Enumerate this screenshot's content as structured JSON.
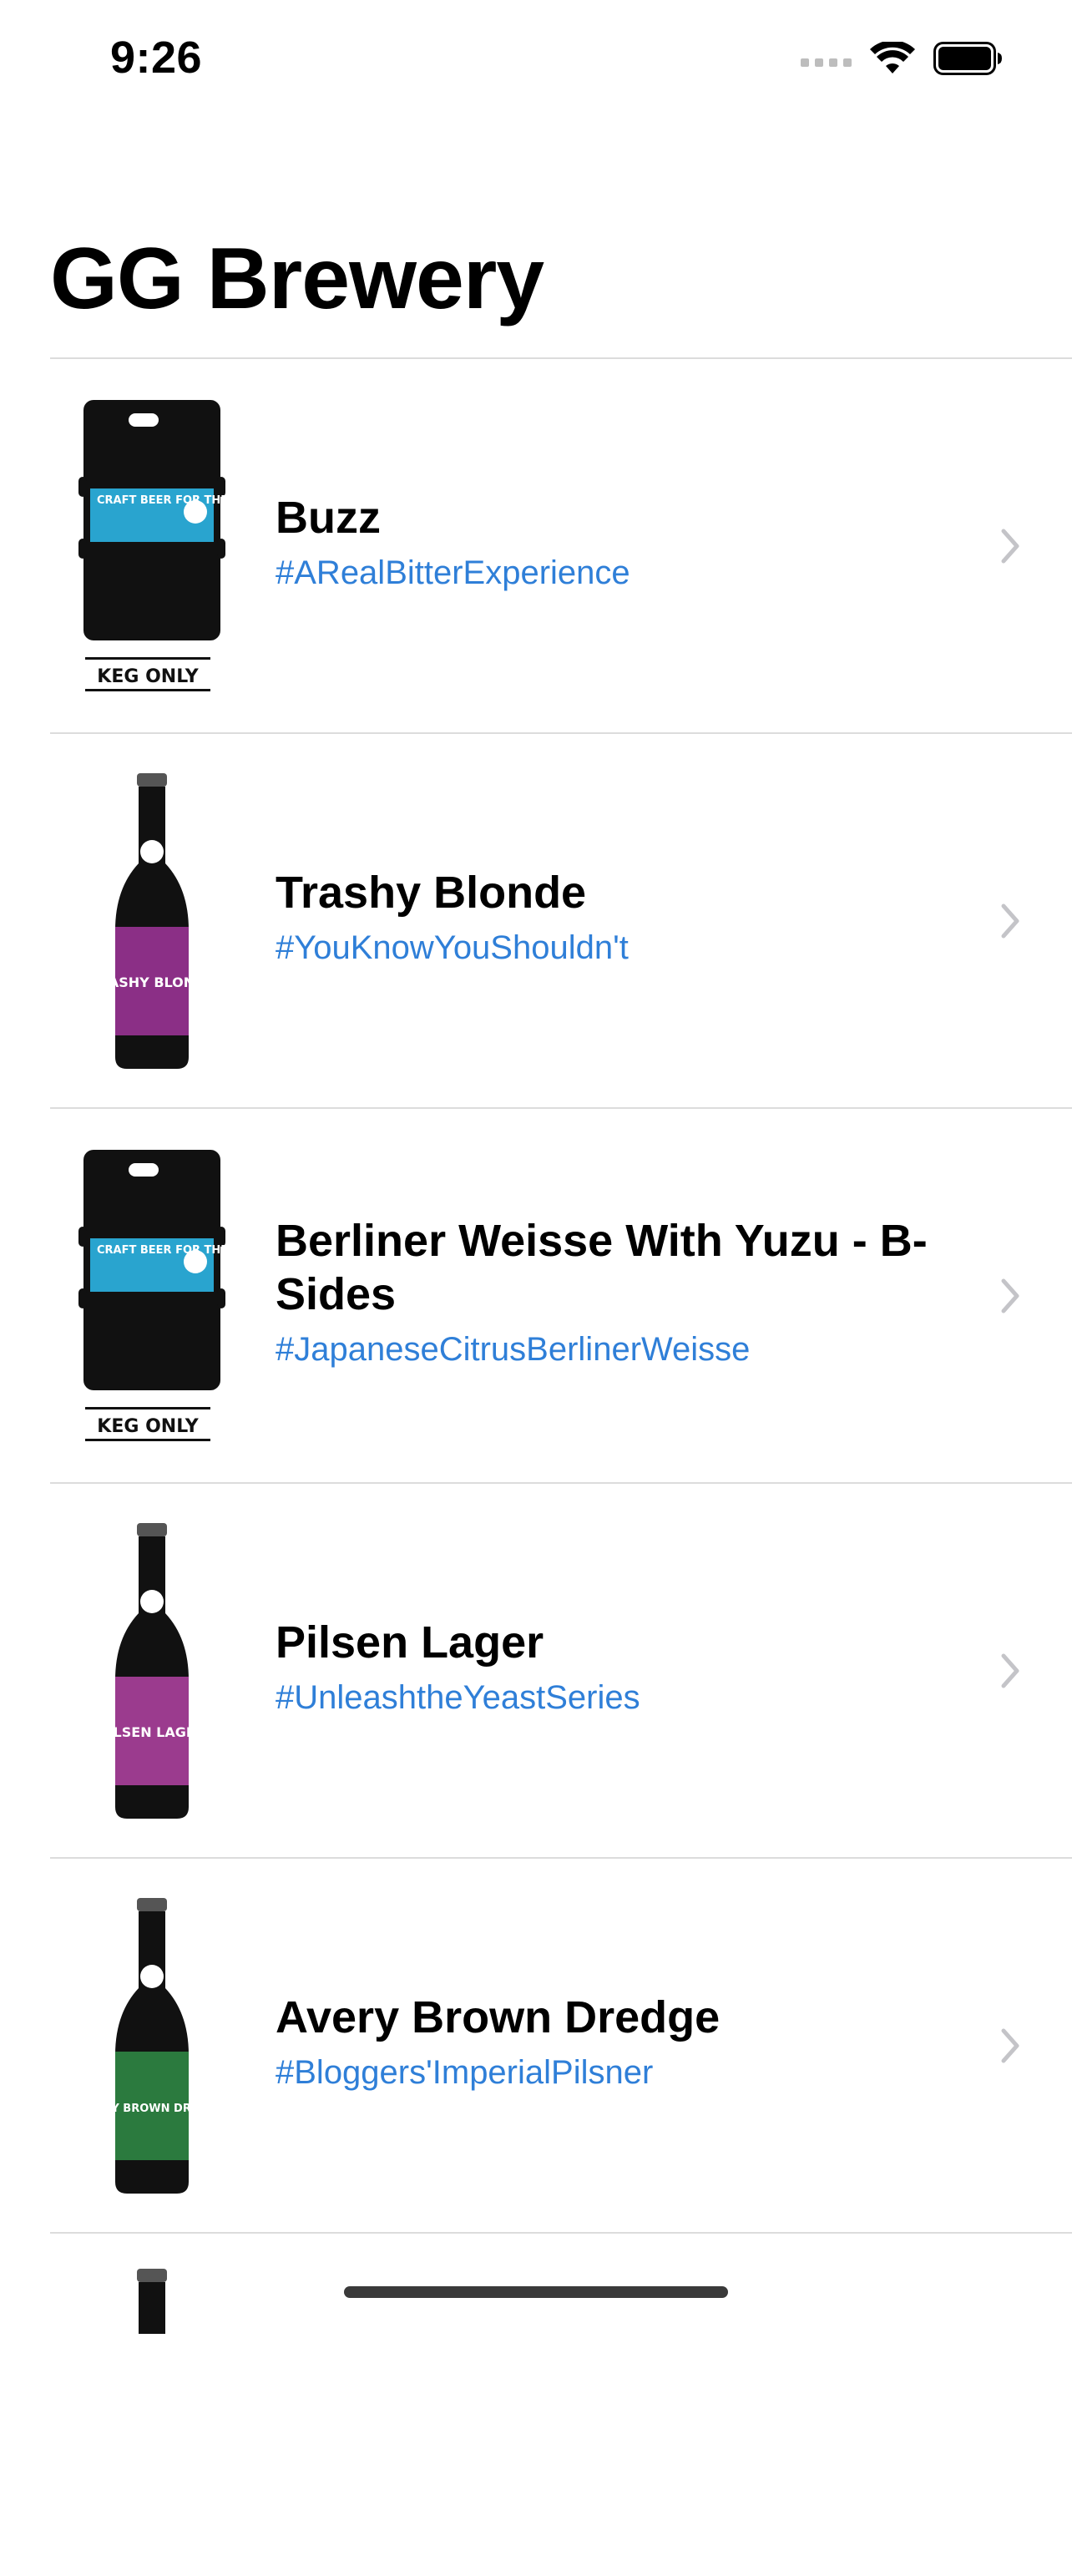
{
  "status_bar": {
    "time": "9:26"
  },
  "title": "GG Brewery",
  "colors": {
    "tagline": "#2f7fd8",
    "separator": "#dcdcdc",
    "chevron": "#c4c4c8"
  },
  "beers": [
    {
      "name": "Buzz",
      "tagline": "#ARealBitterExperience",
      "image": "keg-icon",
      "keg_label": "KEG ONLY",
      "label_text": "CRAFT BEER FOR THE PEOPLE"
    },
    {
      "name": "Trashy Blonde",
      "tagline": "#YouKnowYouShouldn't",
      "image": "bottle-icon",
      "label_color": "#8b2f86",
      "label_text": "TRASHY BLONDE"
    },
    {
      "name": "Berliner Weisse With Yuzu - B-Sides",
      "tagline": "#JapaneseCitrusBerlinerWeisse",
      "image": "keg-icon",
      "keg_label": "KEG ONLY",
      "label_text": "CRAFT BEER FOR THE PEOPLE"
    },
    {
      "name": "Pilsen Lager",
      "tagline": "#UnleashtheYeastSeries",
      "image": "bottle-icon",
      "label_color": "#9b3b8e",
      "label_text": "PILSEN LAGER"
    },
    {
      "name": "Avery Brown Dredge",
      "tagline": "#Bloggers'ImperialPilsner",
      "image": "bottle-icon",
      "label_color": "#2b7a3e",
      "label_text": "AVERY BROWN DREDGE"
    }
  ]
}
